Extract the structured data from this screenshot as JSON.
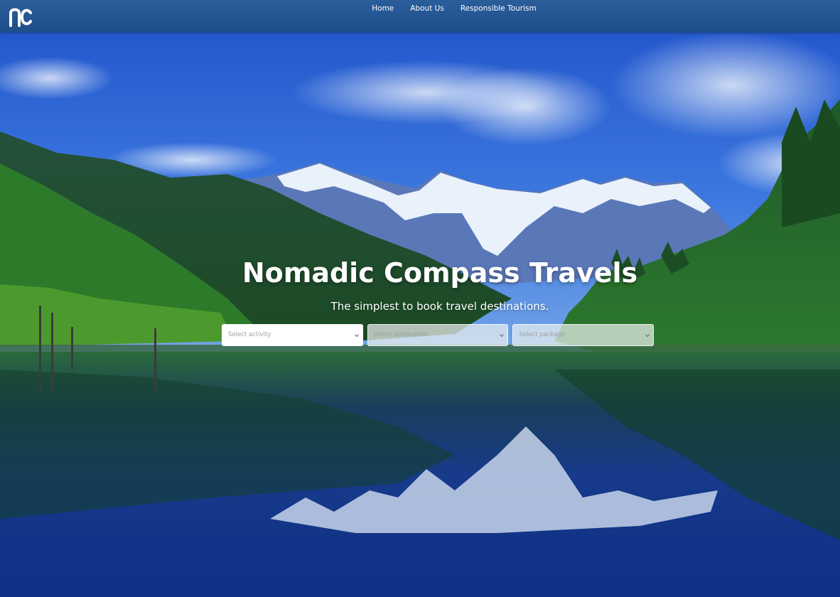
{
  "navbar": {
    "logo_text": "nc",
    "links": [
      "Home",
      "About Us",
      "Responsible Tourism"
    ]
  },
  "hero": {
    "title": "Nomadic Compass Travels",
    "subtitle": "The simplest to book travel destinations."
  },
  "search": {
    "activity_placeholder": "Select activity",
    "destination_placeholder": "Select destination",
    "package_placeholder": "Select package"
  },
  "colors": {
    "navbar": "#1e4f8c",
    "sky": "#2f63d8",
    "water": "#123a8a",
    "forest": "#2c7a2e"
  },
  "icons": {
    "chevron": "chevron-down-icon",
    "logo": "nomadic-compass-logo"
  }
}
